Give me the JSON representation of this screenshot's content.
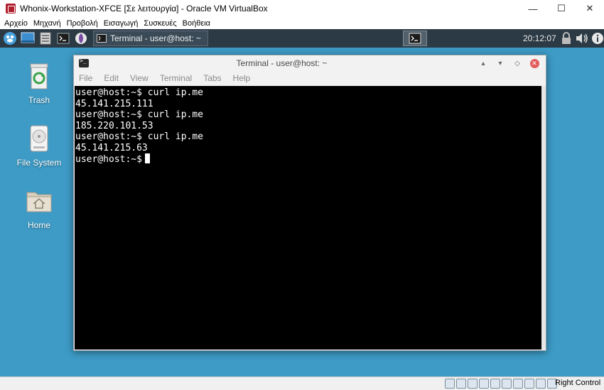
{
  "host_window": {
    "title": "Whonix-Workstation-XFCE [Σε λειτουργία] - Oracle VM VirtualBox",
    "minimize": "—",
    "maximize": "☐",
    "close": "✕"
  },
  "host_menu": [
    "Αρχείο",
    "Μηχανή",
    "Προβολή",
    "Εισαγωγή",
    "Συσκευές",
    "Βοήθεια"
  ],
  "panel": {
    "task_label": "Terminal - user@host: ~",
    "clock": "20:12:07"
  },
  "desktop_icons": [
    {
      "label": "Trash",
      "icon": "trash-icon"
    },
    {
      "label": "File System",
      "icon": "drive-icon"
    },
    {
      "label": "Home",
      "icon": "home-folder-icon"
    }
  ],
  "terminal": {
    "title": "Terminal - user@host: ~",
    "menu": [
      "File",
      "Edit",
      "View",
      "Terminal",
      "Tabs",
      "Help"
    ],
    "lines": [
      "user@host:~$ curl ip.me",
      "45.141.215.111",
      "user@host:~$ curl ip.me",
      "185.220.101.53",
      "user@host:~$ curl ip.me",
      "45.141.215.63"
    ],
    "prompt": "user@host:~$"
  },
  "statusbar": {
    "host_key": "Right Control"
  },
  "colors": {
    "desktop_bg": "#3d9bc6",
    "panel_bg": "#2b3a45",
    "terminal_bg": "#000000",
    "terminal_fg": "#ffffff"
  }
}
